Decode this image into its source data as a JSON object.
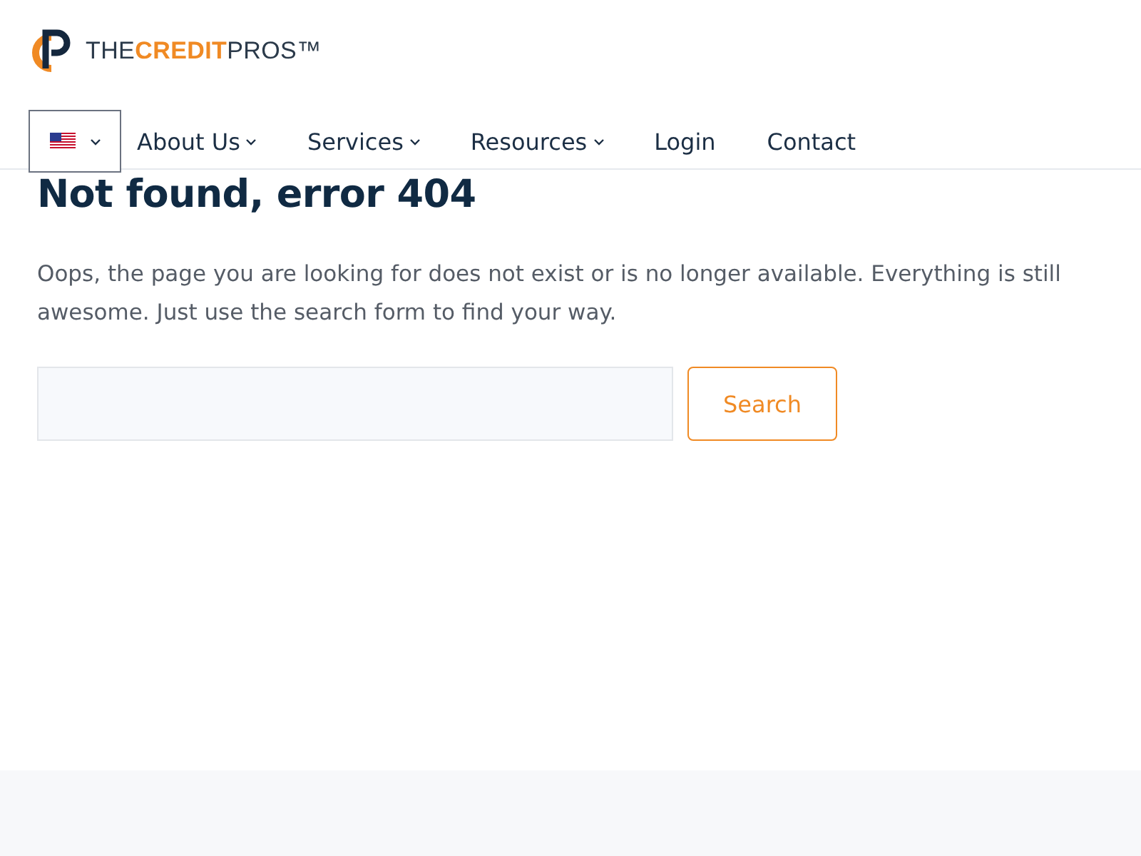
{
  "logo": {
    "words": [
      {
        "text": "THE",
        "kind": "plain"
      },
      {
        "text": "CREDIT",
        "kind": "accent"
      },
      {
        "text": "PROS™",
        "kind": "plain"
      }
    ]
  },
  "nav": [
    {
      "label": "About Us",
      "dropdown": true
    },
    {
      "label": "Services",
      "dropdown": true
    },
    {
      "label": "Resources",
      "dropdown": true
    },
    {
      "label": "Login",
      "dropdown": false
    },
    {
      "label": "Contact",
      "dropdown": false
    }
  ],
  "heading": "Not found, error 404",
  "message": "Oops, the page you are looking for does not exist or is no longer available. Everything is still awesome. Just use the search form to find your way.",
  "search": {
    "button": "Search"
  }
}
